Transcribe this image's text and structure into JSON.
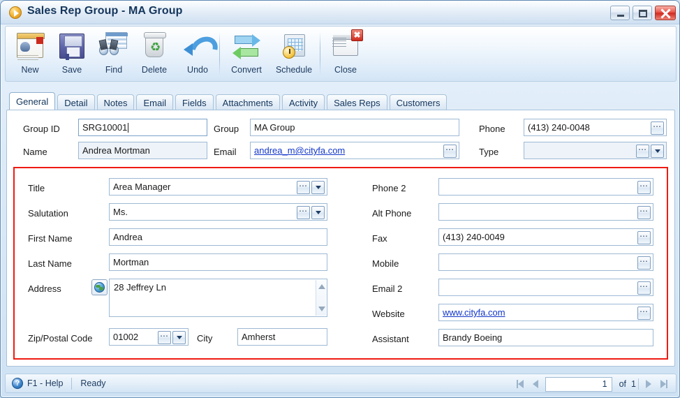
{
  "window": {
    "title": "Sales Rep Group - MA Group",
    "icon": "orange-play-icon",
    "controls": {
      "minimize": "Minimize",
      "maximize": "Maximize",
      "close": "Close"
    }
  },
  "toolbar": {
    "items": [
      {
        "label": "New",
        "icon": "new-record-icon"
      },
      {
        "label": "Save",
        "icon": "floppy-disk-icon"
      },
      {
        "label": "Find",
        "icon": "binoculars-icon"
      },
      {
        "label": "Delete",
        "icon": "recycle-bin-icon"
      },
      {
        "label": "Undo",
        "icon": "undo-arrow-icon"
      },
      {
        "label": "Convert",
        "icon": "convert-arrows-icon"
      },
      {
        "label": "Schedule",
        "icon": "schedule-clock-icon"
      },
      {
        "label": "Close",
        "icon": "close-document-icon"
      }
    ]
  },
  "tabs": [
    {
      "label": "General",
      "active": true
    },
    {
      "label": "Detail",
      "active": false
    },
    {
      "label": "Notes",
      "active": false
    },
    {
      "label": "Email",
      "active": false
    },
    {
      "label": "Fields",
      "active": false
    },
    {
      "label": "Attachments",
      "active": false
    },
    {
      "label": "Activity",
      "active": false
    },
    {
      "label": "Sales Reps",
      "active": false
    },
    {
      "label": "Customers",
      "active": false
    }
  ],
  "header_fields": {
    "group_id": {
      "label": "Group ID",
      "value": "SRG10001"
    },
    "name": {
      "label": "Name",
      "value": "Andrea Mortman"
    },
    "group": {
      "label": "Group",
      "value": "MA Group"
    },
    "email": {
      "label": "Email",
      "value": "andrea_m@cityfa.com"
    },
    "phone": {
      "label": "Phone",
      "value": "(413) 240-0048"
    },
    "type": {
      "label": "Type",
      "value": ""
    }
  },
  "detail_left": {
    "title": {
      "label": "Title",
      "value": "Area Manager"
    },
    "salutation": {
      "label": "Salutation",
      "value": "Ms."
    },
    "first_name": {
      "label": "First Name",
      "value": "Andrea"
    },
    "last_name": {
      "label": "Last Name",
      "value": "Mortman"
    },
    "address": {
      "label": "Address",
      "value": "28 Jeffrey Ln"
    },
    "zip": {
      "label": "Zip/Postal Code",
      "value": "01002"
    },
    "city": {
      "label": "City",
      "value": "Amherst"
    }
  },
  "detail_right": {
    "phone2": {
      "label": "Phone 2",
      "value": ""
    },
    "alt_phone": {
      "label": "Alt Phone",
      "value": ""
    },
    "fax": {
      "label": "Fax",
      "value": "(413) 240-0049"
    },
    "mobile": {
      "label": "Mobile",
      "value": ""
    },
    "email2": {
      "label": "Email 2",
      "value": ""
    },
    "website": {
      "label": "Website",
      "value": "www.cityfa.com"
    },
    "assistant": {
      "label": "Assistant",
      "value": "Brandy Boeing"
    }
  },
  "statusbar": {
    "help_icon": "question-mark-icon",
    "help_label": "F1 - Help",
    "status": "Ready",
    "nav": {
      "page": "1",
      "of_label": "of",
      "total": "1",
      "first": "first-record",
      "prev": "previous-record",
      "next": "next-record",
      "last": "last-record"
    }
  },
  "colors": {
    "highlight_box": "#ee1b12",
    "link": "#1337c9",
    "title_text": "#15365c"
  }
}
